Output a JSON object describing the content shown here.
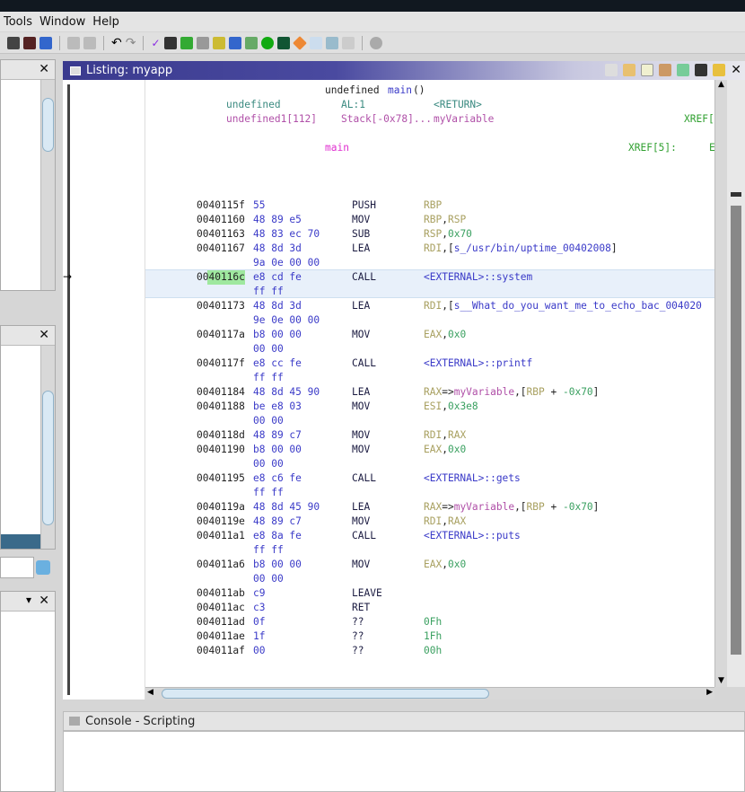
{
  "menu": [
    "Tools",
    "Window",
    "Help"
  ],
  "listing": {
    "title": "Listing:  myapp"
  },
  "console": {
    "title": "Console - Scripting"
  },
  "header": {
    "signature_type": "undefined ",
    "signature_name": "main",
    "signature_paren": "()",
    "ret_type": "undefined",
    "ret_loc": "AL:1",
    "ret_name": "<RETURN>",
    "var_type": "undefined1[112]",
    "var_loc": "Stack[-0x78]...",
    "var_name": "myVariable",
    "var_xref": "XREF[",
    "label": "main",
    "label_xref": "XREF[5]:",
    "label_xref_cont": "E"
  },
  "rows": [
    {
      "addr": "0040115f",
      "bytes": "55",
      "mn": "PUSH",
      "ops": [
        {
          "t": "RBP",
          "c": "reg"
        }
      ]
    },
    {
      "addr": "00401160",
      "bytes": "48 89 e5",
      "mn": "MOV",
      "ops": [
        {
          "t": "RBP",
          "c": "reg"
        },
        {
          "t": ",",
          "c": "punc"
        },
        {
          "t": "RSP",
          "c": "reg"
        }
      ]
    },
    {
      "addr": "00401163",
      "bytes": "48 83 ec 70",
      "mn": "SUB",
      "ops": [
        {
          "t": "RSP",
          "c": "reg"
        },
        {
          "t": ",",
          "c": "punc"
        },
        {
          "t": "0x70",
          "c": "num"
        }
      ]
    },
    {
      "addr": "00401167",
      "bytes": "48 8d 3d",
      "bytes2": "9a 0e 00 00",
      "mn": "LEA",
      "ops": [
        {
          "t": "RDI",
          "c": "reg"
        },
        {
          "t": ",[",
          "c": "punc"
        },
        {
          "t": "s_/usr/bin/uptime_00402008",
          "c": "ref"
        },
        {
          "t": "]",
          "c": "punc"
        }
      ]
    },
    {
      "addr": "0040116c",
      "bytes": "e8 cd fe",
      "bytes2": "ff ff",
      "mn": "CALL",
      "ops": [
        {
          "t": "<EXTERNAL>::system",
          "c": "ref"
        }
      ],
      "selected": true
    },
    {
      "addr": "00401173",
      "bytes": "48 8d 3d",
      "bytes2": "9e 0e 00 00",
      "mn": "LEA",
      "ops": [
        {
          "t": "RDI",
          "c": "reg"
        },
        {
          "t": ",[",
          "c": "punc"
        },
        {
          "t": "s__What_do_you_want_me_to_echo_bac_004020",
          "c": "ref"
        }
      ]
    },
    {
      "addr": "0040117a",
      "bytes": "b8 00 00",
      "bytes2": "00 00",
      "mn": "MOV",
      "ops": [
        {
          "t": "EAX",
          "c": "reg"
        },
        {
          "t": ",",
          "c": "punc"
        },
        {
          "t": "0x0",
          "c": "num"
        }
      ]
    },
    {
      "addr": "0040117f",
      "bytes": "e8 cc fe",
      "bytes2": "ff ff",
      "mn": "CALL",
      "ops": [
        {
          "t": "<EXTERNAL>::printf",
          "c": "ref"
        }
      ]
    },
    {
      "addr": "00401184",
      "bytes": "48 8d 45 90",
      "mn": "LEA",
      "ops": [
        {
          "t": "RAX",
          "c": "reg"
        },
        {
          "t": "=>",
          "c": "punc"
        },
        {
          "t": "myVariable",
          "c": "var"
        },
        {
          "t": ",[",
          "c": "punc"
        },
        {
          "t": "RBP",
          "c": "reg"
        },
        {
          "t": " + ",
          "c": "punc"
        },
        {
          "t": "-0x70",
          "c": "num"
        },
        {
          "t": "]",
          "c": "punc"
        }
      ]
    },
    {
      "addr": "00401188",
      "bytes": "be e8 03",
      "bytes2": "00 00",
      "mn": "MOV",
      "ops": [
        {
          "t": "ESI",
          "c": "reg"
        },
        {
          "t": ",",
          "c": "punc"
        },
        {
          "t": "0x3e8",
          "c": "num"
        }
      ]
    },
    {
      "addr": "0040118d",
      "bytes": "48 89 c7",
      "mn": "MOV",
      "ops": [
        {
          "t": "RDI",
          "c": "reg"
        },
        {
          "t": ",",
          "c": "punc"
        },
        {
          "t": "RAX",
          "c": "reg"
        }
      ]
    },
    {
      "addr": "00401190",
      "bytes": "b8 00 00",
      "bytes2": "00 00",
      "mn": "MOV",
      "ops": [
        {
          "t": "EAX",
          "c": "reg"
        },
        {
          "t": ",",
          "c": "punc"
        },
        {
          "t": "0x0",
          "c": "num"
        }
      ]
    },
    {
      "addr": "00401195",
      "bytes": "e8 c6 fe",
      "bytes2": "ff ff",
      "mn": "CALL",
      "ops": [
        {
          "t": "<EXTERNAL>::gets",
          "c": "ref"
        }
      ]
    },
    {
      "addr": "0040119a",
      "bytes": "48 8d 45 90",
      "mn": "LEA",
      "ops": [
        {
          "t": "RAX",
          "c": "reg"
        },
        {
          "t": "=>",
          "c": "punc"
        },
        {
          "t": "myVariable",
          "c": "var"
        },
        {
          "t": ",[",
          "c": "punc"
        },
        {
          "t": "RBP",
          "c": "reg"
        },
        {
          "t": " + ",
          "c": "punc"
        },
        {
          "t": "-0x70",
          "c": "num"
        },
        {
          "t": "]",
          "c": "punc"
        }
      ]
    },
    {
      "addr": "0040119e",
      "bytes": "48 89 c7",
      "mn": "MOV",
      "ops": [
        {
          "t": "RDI",
          "c": "reg"
        },
        {
          "t": ",",
          "c": "punc"
        },
        {
          "t": "RAX",
          "c": "reg"
        }
      ]
    },
    {
      "addr": "004011a1",
      "bytes": "e8 8a fe",
      "bytes2": "ff ff",
      "mn": "CALL",
      "ops": [
        {
          "t": "<EXTERNAL>::puts",
          "c": "ref"
        }
      ]
    },
    {
      "addr": "004011a6",
      "bytes": "b8 00 00",
      "bytes2": "00 00",
      "mn": "MOV",
      "ops": [
        {
          "t": "EAX",
          "c": "reg"
        },
        {
          "t": ",",
          "c": "punc"
        },
        {
          "t": "0x0",
          "c": "num"
        }
      ]
    },
    {
      "addr": "004011ab",
      "bytes": "c9",
      "mn": "LEAVE",
      "ops": []
    },
    {
      "addr": "004011ac",
      "bytes": "c3",
      "mn": "RET",
      "ops": []
    },
    {
      "addr": "004011ad",
      "bytes": "0f",
      "mn": "??",
      "ops": [
        {
          "t": "0Fh",
          "c": "num"
        }
      ]
    },
    {
      "addr": "004011ae",
      "bytes": "1f",
      "mn": "??",
      "ops": [
        {
          "t": "1Fh",
          "c": "num"
        }
      ]
    },
    {
      "addr": "004011af",
      "bytes": "00",
      "mn": "??",
      "ops": [
        {
          "t": "00h",
          "c": "num"
        }
      ]
    }
  ],
  "colors": {
    "title_bar": "#3a3a8e",
    "selection": "#e8f0fa",
    "address_highlight": "#9fe89f"
  }
}
